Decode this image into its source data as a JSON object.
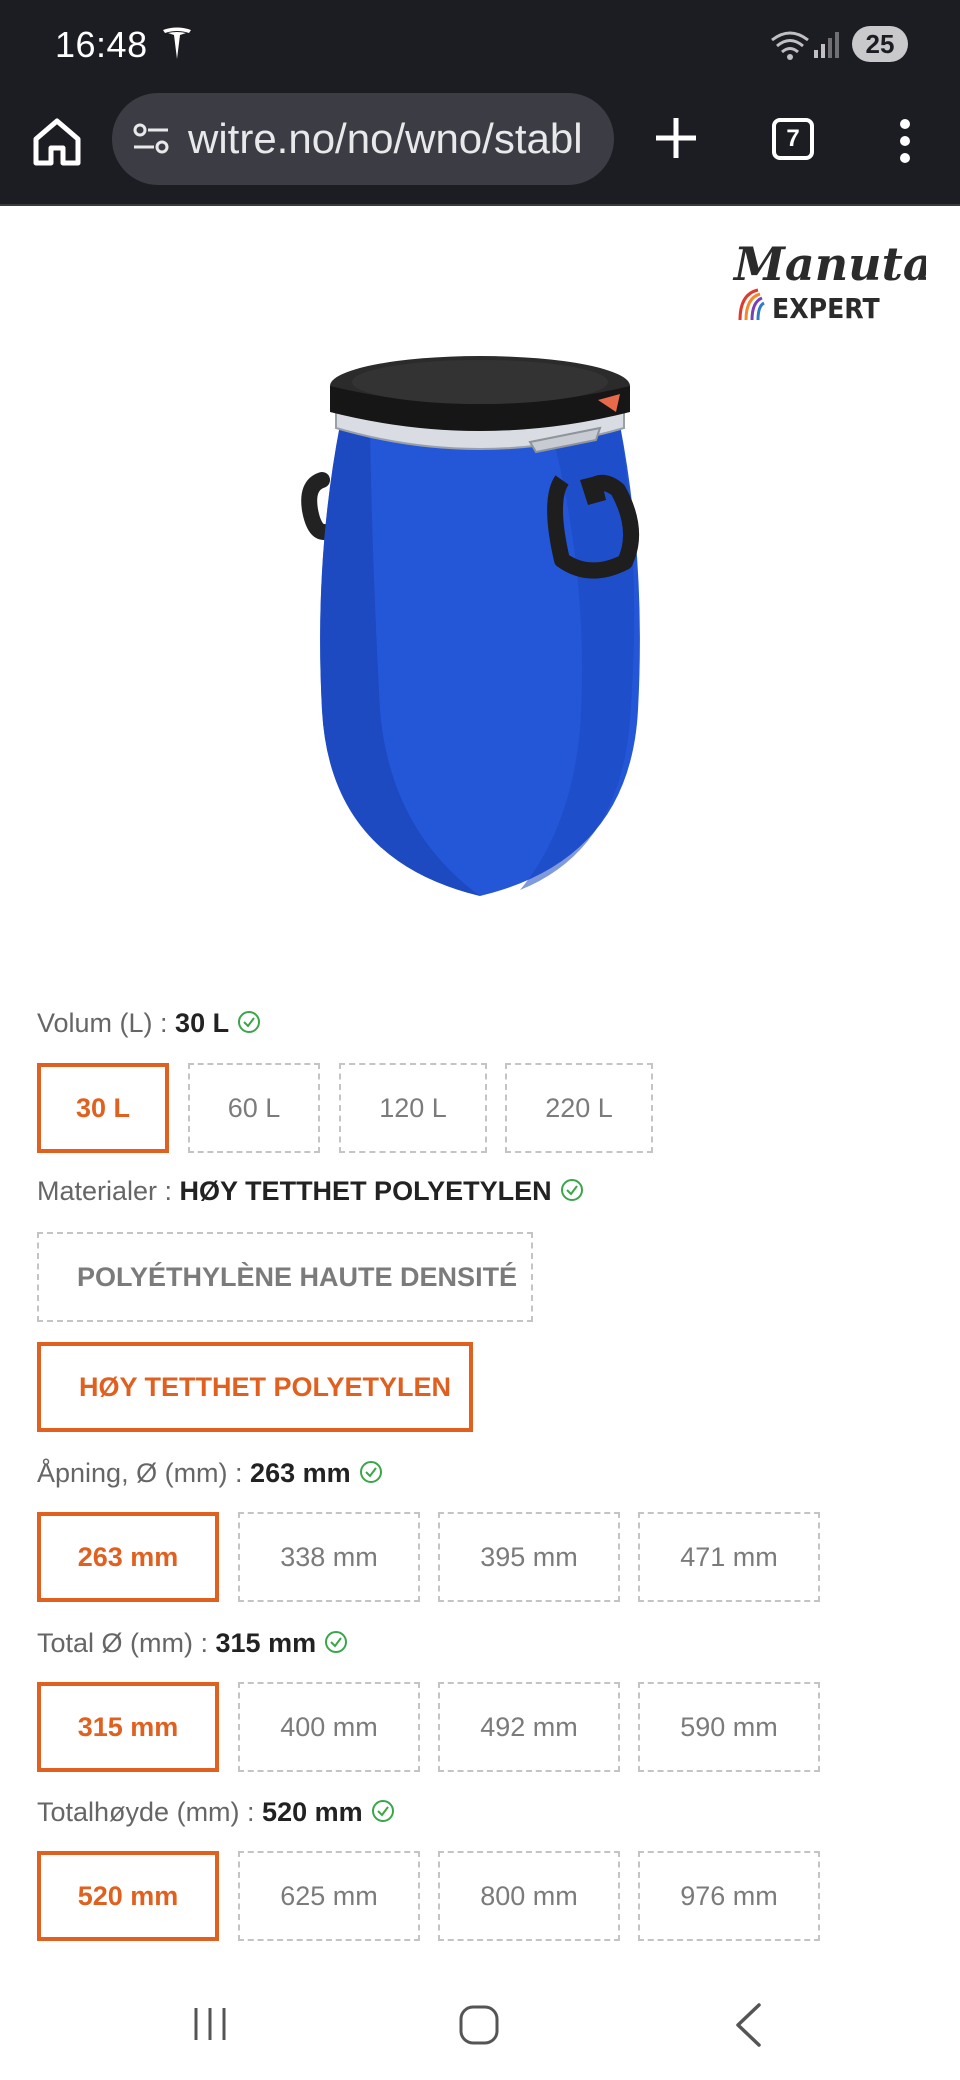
{
  "status_bar": {
    "time": "16:48",
    "battery": "25",
    "icons": [
      "tesla-icon",
      "wifi-icon",
      "signal-icon"
    ]
  },
  "browser": {
    "url": "witre.no/no/wno/stabl",
    "tab_count": "7"
  },
  "brand": {
    "logo_text": "Manutan",
    "logo_subtext": "EXPERT"
  },
  "options": {
    "volume": {
      "label": "Volum (L) : ",
      "value": "30 L",
      "choices": [
        "30 L",
        "60 L",
        "120 L",
        "220 L"
      ],
      "selected_index": 0
    },
    "material": {
      "label": "Materialer : ",
      "value": "HØY TETTHET POLYETYLEN",
      "choices": [
        "POLYÉTHYLÈNE HAUTE DENSITÉ",
        "HØY TETTHET POLYETYLEN"
      ],
      "selected_index": 1
    },
    "opening": {
      "label": "Åpning, Ø (mm) : ",
      "value": "263 mm",
      "choices": [
        "263 mm",
        "338 mm",
        "395 mm",
        "471 mm"
      ],
      "selected_index": 0
    },
    "total_diameter": {
      "label": "Total Ø (mm) : ",
      "value": "315 mm",
      "choices": [
        "315 mm",
        "400 mm",
        "492 mm",
        "590 mm"
      ],
      "selected_index": 0
    },
    "total_height": {
      "label": "Totalhøyde (mm) : ",
      "value": "520 mm",
      "choices": [
        "520 mm",
        "625 mm",
        "800 mm",
        "976 mm"
      ],
      "selected_index": 0
    }
  },
  "colors": {
    "accent": "#e0601f",
    "check": "#3aa64a",
    "barrel_blue": "#2156d6",
    "chrome_dark": "#1c1d22"
  }
}
